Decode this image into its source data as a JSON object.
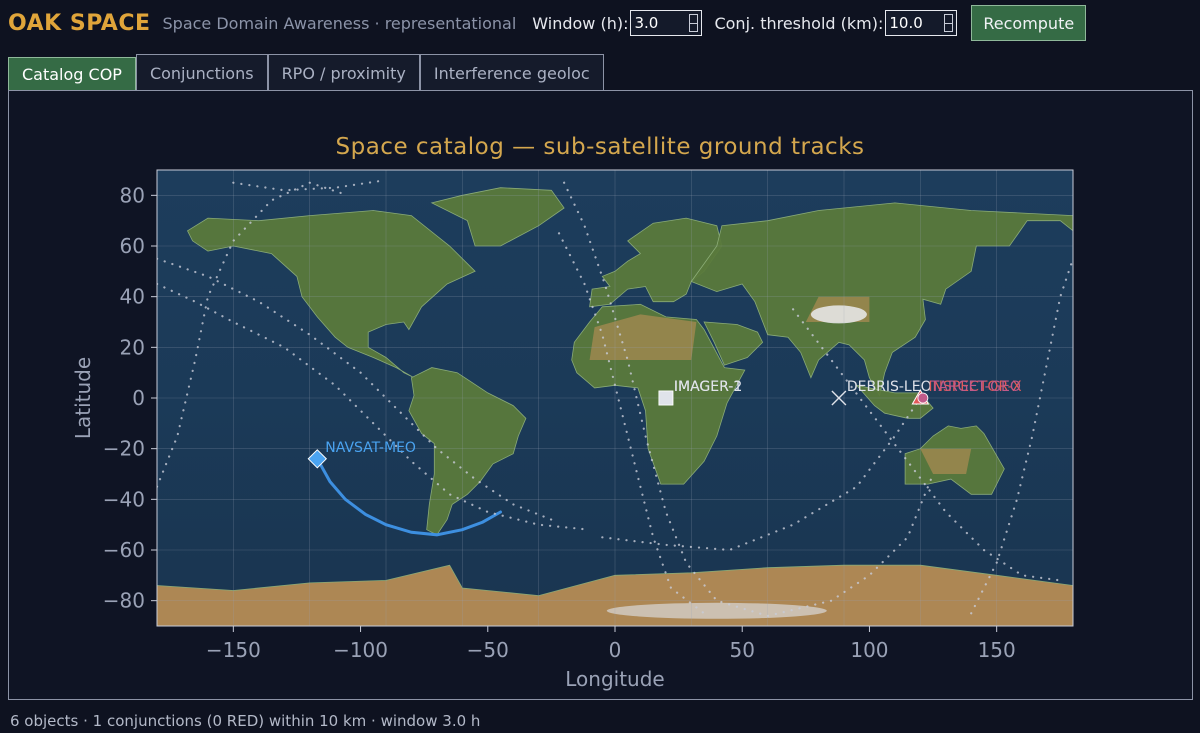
{
  "header": {
    "brand": "OAK SPACE",
    "subtitle": "Space Domain Awareness · representational",
    "window_label": "Window (h):",
    "window_value": "3.0",
    "threshold_label": "Conj. threshold (km):",
    "threshold_value": "10.0",
    "recompute_label": "Recompute"
  },
  "tabs": [
    {
      "label": "Catalog COP",
      "active": true
    },
    {
      "label": "Conjunctions",
      "active": false
    },
    {
      "label": "RPO / proximity",
      "active": false
    },
    {
      "label": "Interference geoloc",
      "active": false
    }
  ],
  "chart_data": {
    "type": "scatter",
    "title": "Space catalog — sub-satellite ground tracks",
    "xlabel": "Longitude",
    "ylabel": "Latitude",
    "xlim": [
      -180,
      180
    ],
    "ylim": [
      -90,
      90
    ],
    "xticks": [
      -150,
      -100,
      -50,
      0,
      50,
      100,
      150
    ],
    "yticks": [
      80,
      60,
      40,
      20,
      0,
      -20,
      -40,
      -60,
      -80
    ],
    "grid": true,
    "background": "world relief map",
    "objects": [
      {
        "name": "NAVSAT-MEO",
        "lon": -117,
        "lat": -24,
        "marker": "diamond",
        "color": "#4aa3f0"
      },
      {
        "name": "IMAGER-1",
        "lon": 20,
        "lat": 0,
        "marker": "square",
        "color": "#e0e3ea"
      },
      {
        "name": "IMAGER-2",
        "lon": 20,
        "lat": 0,
        "marker": "square",
        "color": "#e0e3ea"
      },
      {
        "name": "DEBRIS-LEO",
        "lon": 88,
        "lat": 0,
        "marker": "x",
        "color": "#e0e3ea"
      },
      {
        "name": "INSPECTOR-X",
        "lon": 120,
        "lat": 0,
        "marker": "triangle",
        "color": "#e25a5a"
      },
      {
        "name": "TARGET-GEO",
        "lon": 121,
        "lat": 0,
        "marker": "circle",
        "color": "#c05a8a"
      }
    ],
    "tracks": [
      {
        "name": "NAVSAT-MEO",
        "style": "solid",
        "color": "#3d8fe0",
        "points": [
          [
            -117,
            -24
          ],
          [
            -112,
            -33
          ],
          [
            -106,
            -40
          ],
          [
            -98,
            -46
          ],
          [
            -90,
            -50
          ],
          [
            -80,
            -53
          ],
          [
            -70,
            -54
          ],
          [
            -60,
            -52
          ],
          [
            -52,
            -49
          ],
          [
            -45,
            -45
          ]
        ]
      },
      {
        "name": "polar-1",
        "style": "dotted",
        "color": "#c8ccd8",
        "points": [
          [
            -180,
            -35
          ],
          [
            -172,
            -15
          ],
          [
            -165,
            15
          ],
          [
            -160,
            40
          ],
          [
            -150,
            62
          ],
          [
            -135,
            78
          ],
          [
            -120,
            85
          ],
          [
            -105,
            80
          ]
        ]
      },
      {
        "name": "polar-2",
        "style": "dotted",
        "color": "#c8ccd8",
        "points": [
          [
            -180,
            45
          ],
          [
            -165,
            38
          ],
          [
            -150,
            30
          ],
          [
            -130,
            20
          ],
          [
            -110,
            5
          ],
          [
            -95,
            -10
          ],
          [
            -80,
            -25
          ],
          [
            -65,
            -38
          ],
          [
            -50,
            -45
          ],
          [
            -30,
            -50
          ],
          [
            -10,
            -52
          ]
        ]
      },
      {
        "name": "polar-3",
        "style": "dotted",
        "color": "#c8ccd8",
        "points": [
          [
            -180,
            55
          ],
          [
            -160,
            48
          ],
          [
            -140,
            38
          ],
          [
            -120,
            25
          ],
          [
            -100,
            10
          ],
          [
            -85,
            -5
          ],
          [
            -70,
            -20
          ],
          [
            -55,
            -32
          ],
          [
            -40,
            -42
          ],
          [
            -25,
            -48
          ]
        ]
      },
      {
        "name": "polar-4",
        "style": "dotted",
        "color": "#c8ccd8",
        "points": [
          [
            -22,
            65
          ],
          [
            -12,
            45
          ],
          [
            -5,
            25
          ],
          [
            0,
            5
          ],
          [
            5,
            -15
          ],
          [
            10,
            -35
          ],
          [
            15,
            -55
          ],
          [
            22,
            -75
          ],
          [
            35,
            -85
          ]
        ]
      },
      {
        "name": "polar-5",
        "style": "dotted",
        "color": "#c8ccd8",
        "points": [
          [
            -20,
            85
          ],
          [
            -12,
            68
          ],
          [
            -4,
            45
          ],
          [
            5,
            15
          ],
          [
            12,
            -15
          ],
          [
            20,
            -45
          ],
          [
            28,
            -65
          ],
          [
            40,
            -80
          ],
          [
            60,
            -86
          ],
          [
            85,
            -80
          ],
          [
            100,
            -70
          ],
          [
            115,
            -55
          ],
          [
            125,
            -30
          ]
        ]
      },
      {
        "name": "polar-6",
        "style": "dotted",
        "color": "#c8ccd8",
        "points": [
          [
            -5,
            -55
          ],
          [
            20,
            -58
          ],
          [
            45,
            -60
          ],
          [
            70,
            -50
          ],
          [
            95,
            -35
          ],
          [
            110,
            -15
          ],
          [
            120,
            0
          ]
        ]
      },
      {
        "name": "polar-7",
        "style": "dotted",
        "color": "#c8ccd8",
        "points": [
          [
            70,
            35
          ],
          [
            85,
            15
          ],
          [
            100,
            -5
          ],
          [
            115,
            -25
          ],
          [
            130,
            -45
          ],
          [
            145,
            -60
          ],
          [
            160,
            -70
          ],
          [
            175,
            -72
          ]
        ]
      },
      {
        "name": "polar-8",
        "style": "dotted",
        "color": "#c8ccd8",
        "points": [
          [
            140,
            -85
          ],
          [
            150,
            -65
          ],
          [
            158,
            -40
          ],
          [
            164,
            -15
          ],
          [
            170,
            15
          ],
          [
            175,
            40
          ],
          [
            180,
            55
          ]
        ]
      },
      {
        "name": "polar-9",
        "style": "dotted",
        "color": "#c8ccd8",
        "points": [
          [
            -150,
            85
          ],
          [
            -130,
            82
          ],
          [
            -110,
            83
          ],
          [
            -90,
            86
          ]
        ]
      }
    ]
  },
  "status": {
    "text": "6 objects · 1 conjunctions (0 RED) within 10 km · window 3.0 h"
  }
}
